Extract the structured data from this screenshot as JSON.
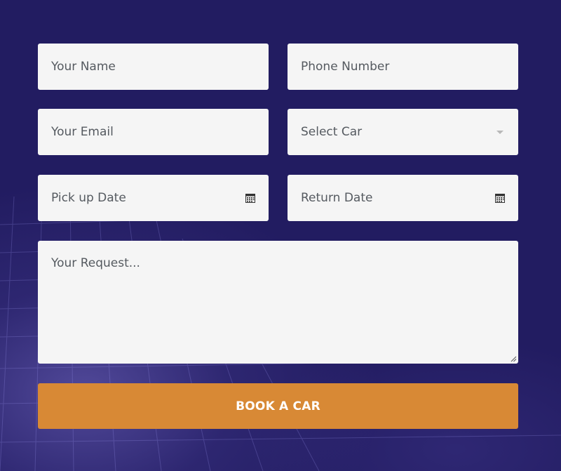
{
  "form": {
    "name": {
      "placeholder": "Your Name",
      "value": ""
    },
    "phone": {
      "placeholder": "Phone Number",
      "value": ""
    },
    "email": {
      "placeholder": "Your Email",
      "value": ""
    },
    "car_select": {
      "selected": "Select Car"
    },
    "pickup_date": {
      "label": "Pick up Date"
    },
    "return_date": {
      "label": "Return Date"
    },
    "request": {
      "placeholder": "Your Request...",
      "value": ""
    },
    "submit_label": "BOOK A CAR"
  },
  "icons": {
    "select_caret": "chevron-down-icon",
    "date_picker": "calendar-icon"
  },
  "colors": {
    "background": "#221c61",
    "field_background": "#f5f5f5",
    "field_text": "#555a60",
    "button": "#d88935",
    "button_text": "#ffffff"
  }
}
